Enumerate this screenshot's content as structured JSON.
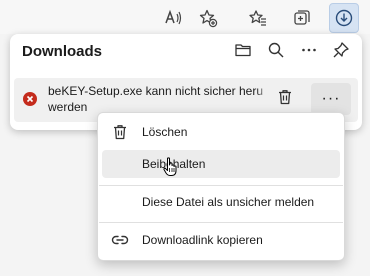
{
  "toolbar": {
    "buttons": [
      {
        "name": "read-aloud-icon"
      },
      {
        "name": "add-favorite-icon"
      },
      {
        "name": "favorites-icon"
      },
      {
        "name": "collections-icon"
      },
      {
        "name": "downloads-icon",
        "active": true
      }
    ]
  },
  "downloads_panel": {
    "title": "Downloads",
    "actions": [
      "open-folder-icon",
      "search-icon",
      "more-options-icon",
      "pin-icon"
    ],
    "item": {
      "status_icon": "error-icon",
      "line1": "beKEY-Setup.exe kann nicht sicher heru",
      "line2": "werden",
      "delete_icon": "trash-icon",
      "more_label": "···"
    }
  },
  "context_menu": {
    "items": [
      {
        "label": "Löschen",
        "icon": "trash-icon"
      },
      {
        "label": "Beibehalten",
        "icon": ""
      },
      {
        "label": "Diese Datei als unsicher melden",
        "icon": ""
      },
      {
        "label": "Downloadlink kopieren",
        "icon": "link-icon"
      }
    ]
  },
  "colors": {
    "accent_active": "#d6e3f3",
    "error": "#c42b1c",
    "hover": "#ececec"
  }
}
